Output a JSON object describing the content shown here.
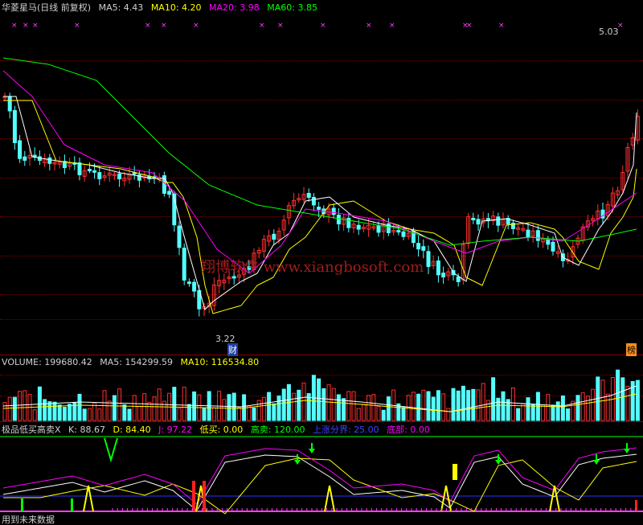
{
  "price_header": {
    "stock": "华菱星马(日线 前复权)",
    "ma5": "MA5: 4.43",
    "ma10": "MA10: 4.20",
    "ma20": "MA20: 3.98",
    "ma60": "MA60: 3.85"
  },
  "price_labels": {
    "high": "5.03",
    "low": "3.22",
    "cai_badge": "财",
    "bang_badge": "榜"
  },
  "watermark": "翔博软件 www.xiangbosoft.com",
  "volume_header": {
    "volume": "VOLUME: 199680.42",
    "ma5": "MA5: 154299.59",
    "ma10": "MA10: 116534.80"
  },
  "indicator_header": {
    "name": "极品低买高卖X",
    "k": "K: 88.67",
    "d": "D: 84.40",
    "j": "J: 97.22",
    "low_buy": "低买: 0.00",
    "high_sell": "高卖: 120.00",
    "trend_line": "上涨分界: 25.00",
    "bottom": "底部: 0.00"
  },
  "footer": {
    "future_data": "用到未来数据"
  },
  "colors": {
    "up": "#ff3030",
    "down": "#54ffff",
    "ma5": "#ffffff",
    "ma10": "#ffff00",
    "ma20": "#ff00ff",
    "ma60": "#00ff00",
    "grid": "#7a0000",
    "label_white": "#d0d0d0",
    "label_yellow": "#ffff00",
    "label_magenta": "#ff00ff",
    "label_green": "#00ff00",
    "label_blue": "#4040ff"
  }
}
